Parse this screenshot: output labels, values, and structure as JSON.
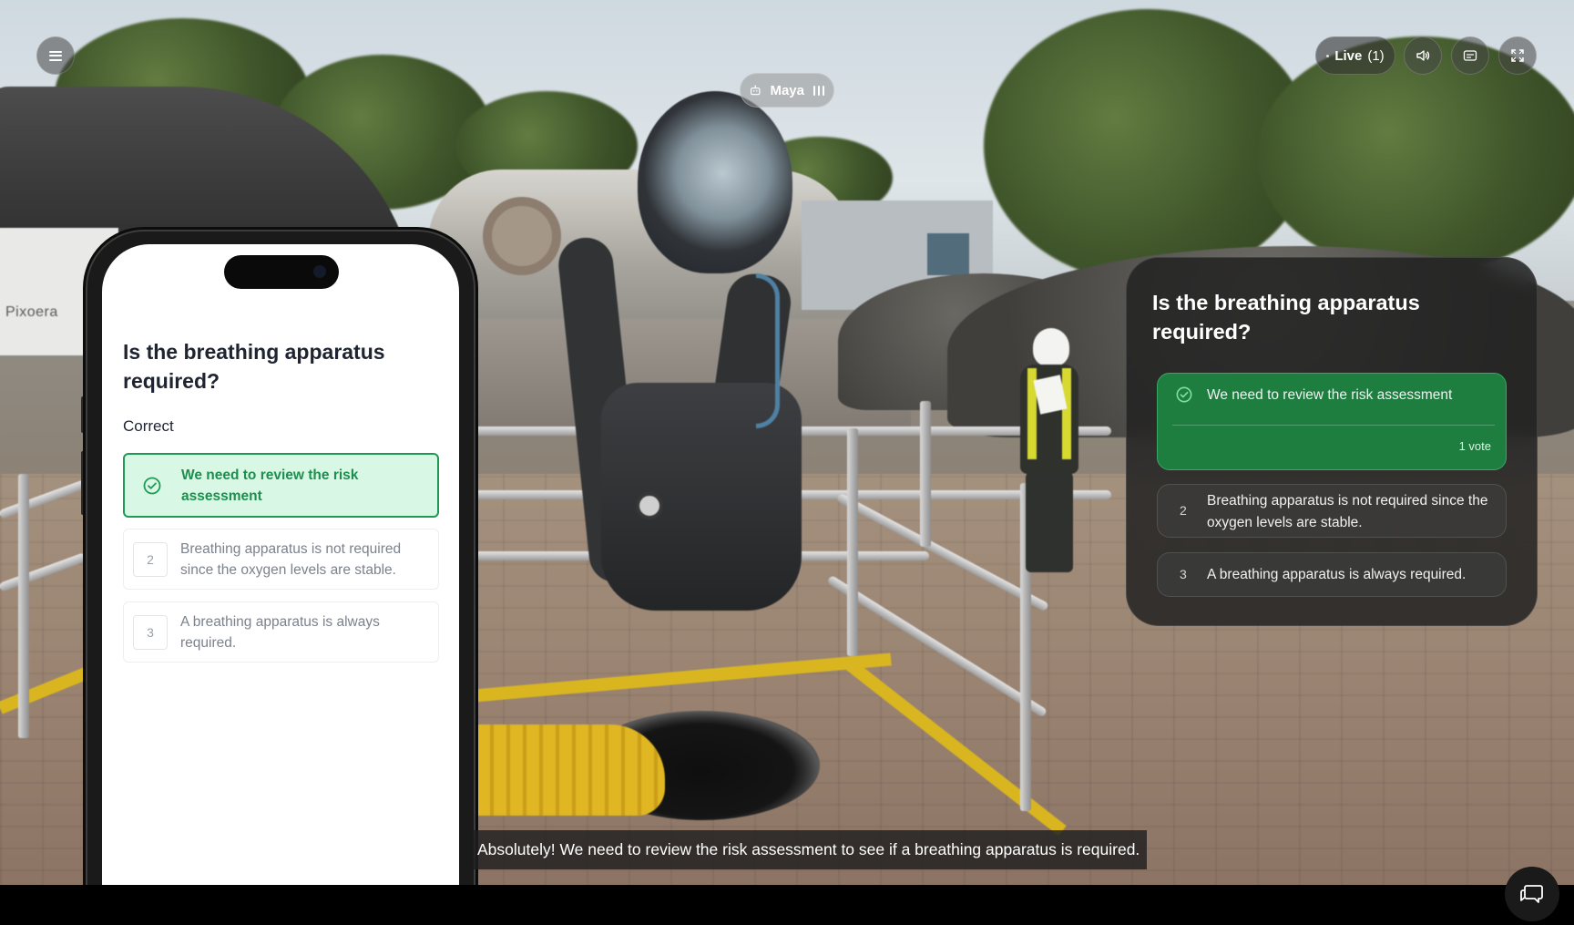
{
  "topbar": {
    "menu_icon": "hamburger-menu-icon",
    "live_label": "Live",
    "live_count": "(1)",
    "sound_icon": "speaker-icon",
    "captions_icon": "captions-icon",
    "fullscreen_icon": "fullscreen-icon"
  },
  "assistant": {
    "name": "Maya",
    "icon": "robot-icon",
    "status_icon": "audio-wave-icon"
  },
  "scene": {
    "watermark_text": "Pixoera"
  },
  "phone": {
    "question": "Is the breathing apparatus required?",
    "status": "Correct",
    "options": [
      {
        "number": "1",
        "text": "We need to review the risk assessment",
        "state": "correct"
      },
      {
        "number": "2",
        "text": "Breathing apparatus is not required since the oxygen levels are stable.",
        "state": "neutral"
      },
      {
        "number": "3",
        "text": "A breathing apparatus is always required.",
        "state": "neutral"
      }
    ]
  },
  "quiz_card": {
    "question": "Is the breathing apparatus required?",
    "options": [
      {
        "number": "1",
        "text": "We need to review the risk assessment",
        "votes": "1 vote",
        "state": "correct"
      },
      {
        "number": "2",
        "text": "Breathing apparatus is not required since the oxygen levels are stable.",
        "state": "neutral"
      },
      {
        "number": "3",
        "text": "A breathing apparatus is always required.",
        "state": "neutral"
      }
    ]
  },
  "subtitle": {
    "text": "Absolutely! We need to review the risk assessment to see if a breathing apparatus is required."
  },
  "chat": {
    "icon": "chat-bubbles-icon"
  },
  "colors": {
    "correct_green": "#1f9a55",
    "correct_bg_light": "#d9f7e5",
    "card_correct": "#1e7e40"
  }
}
